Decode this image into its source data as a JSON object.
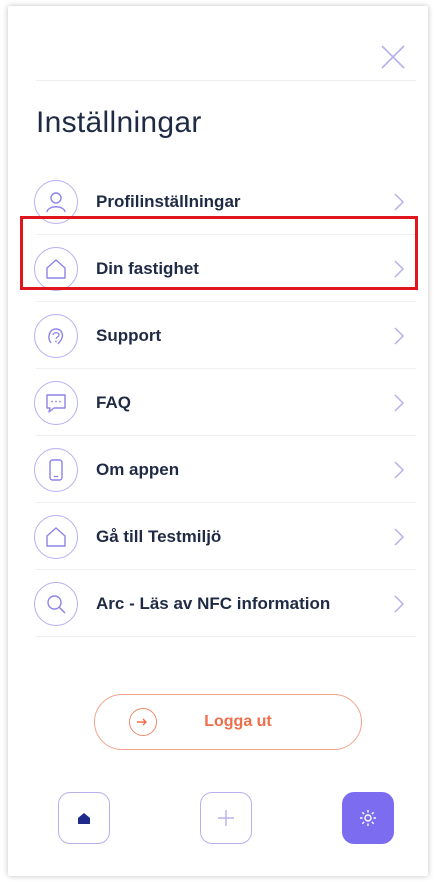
{
  "header": {
    "title": "Inställningar",
    "close_icon": "close-icon"
  },
  "menu": {
    "items": [
      {
        "label": "Profilinställningar",
        "icon": "user-icon"
      },
      {
        "label": "Din fastighet",
        "icon": "house-icon"
      },
      {
        "label": "Support",
        "icon": "support-icon"
      },
      {
        "label": "FAQ",
        "icon": "chat-icon"
      },
      {
        "label": "Om appen",
        "icon": "phone-icon"
      },
      {
        "label": "Gå till Testmiljö",
        "icon": "house-icon"
      },
      {
        "label": "Arc - Läs av NFC information",
        "icon": "search-icon"
      }
    ]
  },
  "logout": {
    "label": "Logga ut",
    "icon": "logout-icon"
  },
  "bottom_nav": {
    "items": [
      {
        "icon": "home-icon"
      },
      {
        "icon": "plus-icon"
      },
      {
        "icon": "gear-icon"
      }
    ]
  },
  "colors": {
    "accent": "#7c6cf0",
    "icon_border": "#b7b0ee",
    "text": "#1f2a44",
    "logout": "#ee6e4a",
    "highlight": "#e0161e"
  }
}
